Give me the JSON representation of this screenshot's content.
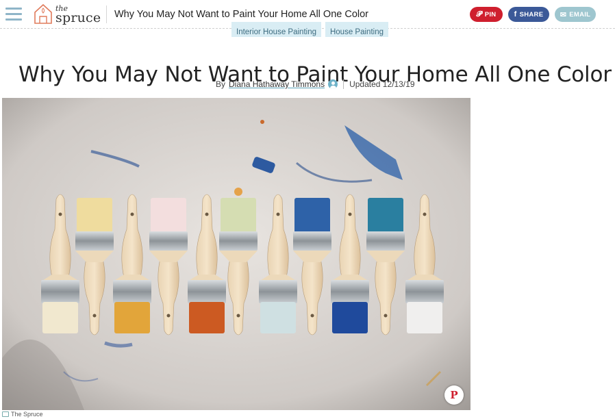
{
  "header": {
    "logo_top": "the",
    "logo_bottom": "spruce",
    "title": "Why You May Not Want to Paint Your Home All One Color",
    "social": {
      "pin_label": "PIN",
      "share_label": "SHARE",
      "email_label": "EMAIL"
    },
    "icons": {
      "menu": "hamburger-icon",
      "pin": "pinterest-icon",
      "share": "facebook-icon",
      "email": "envelope-icon"
    },
    "colors": {
      "pin": "#cf1f2e",
      "share": "#3b5998",
      "email": "#9ec6cf",
      "menu": "#8fb5c8"
    }
  },
  "tags": [
    "Interior House Painting",
    "House Painting"
  ],
  "article": {
    "headline": "Why You May Not Want to Paint Your Home All One Color",
    "by_prefix": "By",
    "author": "Diana Hathaway Timmons",
    "updated": "Updated 12/13/19"
  },
  "hero": {
    "alt": "paint brushes",
    "pin_glyph": "P",
    "credit": "The Spruce"
  }
}
